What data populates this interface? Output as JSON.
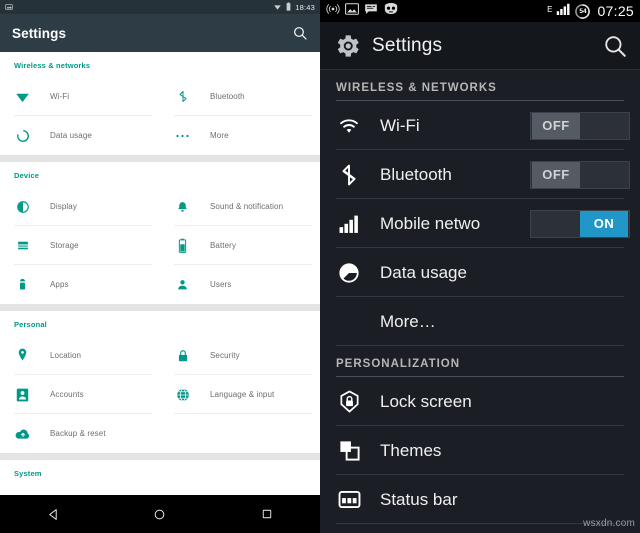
{
  "left_phone": {
    "statusbar": {
      "time": "18:43",
      "icons": [
        "screenshot-icon",
        "wifi-icon",
        "battery-icon"
      ]
    },
    "appbar": {
      "title": "Settings",
      "search_icon": "search-icon"
    },
    "sections": [
      {
        "title": "Wireless & networks",
        "rows": [
          [
            {
              "label": "Wi-Fi",
              "icon": "wifi-icon"
            },
            {
              "label": "Bluetooth",
              "icon": "bluetooth-icon"
            }
          ],
          [
            {
              "label": "Data usage",
              "icon": "data-usage-icon"
            },
            {
              "label": "More",
              "icon": "more-dots-icon"
            }
          ]
        ]
      },
      {
        "title": "Device",
        "rows": [
          [
            {
              "label": "Display",
              "icon": "display-icon"
            },
            {
              "label": "Sound & notification",
              "icon": "bell-icon"
            }
          ],
          [
            {
              "label": "Storage",
              "icon": "storage-icon"
            },
            {
              "label": "Battery",
              "icon": "battery-icon"
            }
          ],
          [
            {
              "label": "Apps",
              "icon": "apps-android-icon"
            },
            {
              "label": "Users",
              "icon": "user-icon"
            }
          ]
        ]
      },
      {
        "title": "Personal",
        "rows": [
          [
            {
              "label": "Location",
              "icon": "location-pin-icon"
            },
            {
              "label": "Security",
              "icon": "lock-icon"
            }
          ],
          [
            {
              "label": "Accounts",
              "icon": "accounts-icon"
            },
            {
              "label": "Language & input",
              "icon": "globe-icon"
            }
          ],
          [
            {
              "label": "Backup & reset",
              "icon": "cloud-upload-icon"
            },
            {
              "label": "",
              "icon": ""
            }
          ]
        ]
      },
      {
        "title": "System",
        "rows": []
      }
    ],
    "navbar": {
      "back": "back-triangle-icon",
      "home": "home-circle-icon",
      "recents": "recents-square-icon"
    },
    "accent_color": "#009887",
    "appbar_color": "#2e3d45"
  },
  "right_phone": {
    "statusbar": {
      "time": "07:25",
      "battery_percent": "54",
      "network_type": "E",
      "notification_icons": [
        "broadcast-icon",
        "image-icon",
        "message-icon",
        "cyanogenmod-icon"
      ],
      "system_icons": [
        "signal-bars-icon",
        "battery-circle-icon"
      ]
    },
    "appbar": {
      "title": "Settings",
      "gear_icon": "gear-icon",
      "search_icon": "search-icon"
    },
    "sections": [
      {
        "title": "WIRELESS & NETWORKS",
        "items": [
          {
            "label": "Wi-Fi",
            "icon": "wifi-icon",
            "toggle": "OFF",
            "toggle_state": "off"
          },
          {
            "label": "Bluetooth",
            "icon": "bluetooth-icon",
            "toggle": "OFF",
            "toggle_state": "off"
          },
          {
            "label": "Mobile netwo",
            "icon": "signal-bars-icon",
            "toggle": "ON",
            "toggle_state": "on"
          },
          {
            "label": "Data usage",
            "icon": "data-usage-icon",
            "toggle": null,
            "toggle_state": null
          },
          {
            "label": "More…",
            "icon": null,
            "toggle": null,
            "toggle_state": null
          }
        ]
      },
      {
        "title": "PERSONALIZATION",
        "items": [
          {
            "label": "Lock screen",
            "icon": "lock-shield-icon",
            "toggle": null,
            "toggle_state": null
          },
          {
            "label": "Themes",
            "icon": "themes-icon",
            "toggle": null,
            "toggle_state": null
          },
          {
            "label": "Status bar",
            "icon": "status-bar-icon",
            "toggle": null,
            "toggle_state": null
          }
        ]
      }
    ],
    "toggle_on_color": "#2196c9",
    "background_color": "#1b1e24"
  },
  "watermark": "wsxdn.com"
}
